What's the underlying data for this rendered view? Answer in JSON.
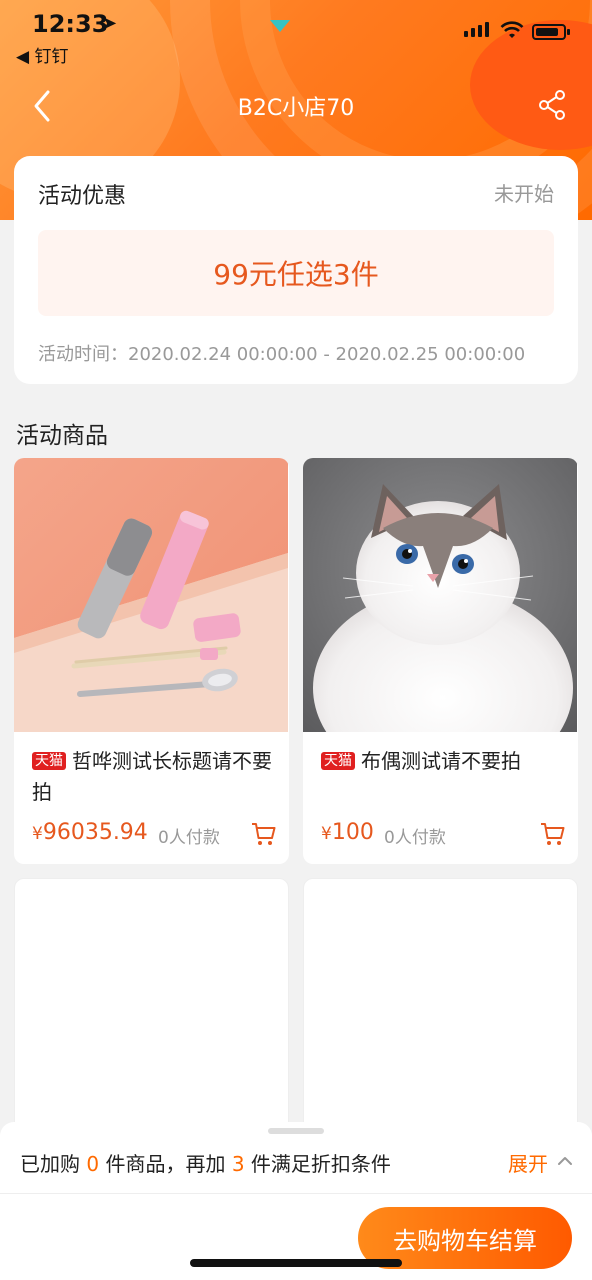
{
  "status_bar": {
    "time": "12:33",
    "back_app": "◀ 钉钉"
  },
  "nav": {
    "title": "B2C小店70",
    "back_icon": "chevron-left",
    "share_icon": "share"
  },
  "promo": {
    "title": "活动优惠",
    "status": "未开始",
    "deal": "99元任选3件",
    "time": "活动时间：2020.02.24 00:00:00 - 2020.02.25 00:00:00"
  },
  "section": {
    "title": "活动商品"
  },
  "products": [
    {
      "badge": "天猫",
      "name": "哲哗测试长标题请不要拍",
      "currency": "¥",
      "price": "96035.94",
      "sold": "0人付款",
      "image": "pastel-chopsticks-spoon-set"
    },
    {
      "badge": "天猫",
      "name": "布偶测试请不要拍",
      "currency": "¥",
      "price": "100",
      "sold": "0人付款",
      "image": "white-ragdoll-cat"
    }
  ],
  "summary": {
    "prefix": "已加购 ",
    "added": "0",
    "middle": " 件商品，再加 ",
    "need": "3",
    "suffix": " 件满足折扣条件",
    "expand": "展开"
  },
  "checkout": {
    "label": "去购物车结算"
  },
  "colors": {
    "accent": "#ff6a00",
    "price": "#e6581e",
    "tmall": "#e02020"
  }
}
